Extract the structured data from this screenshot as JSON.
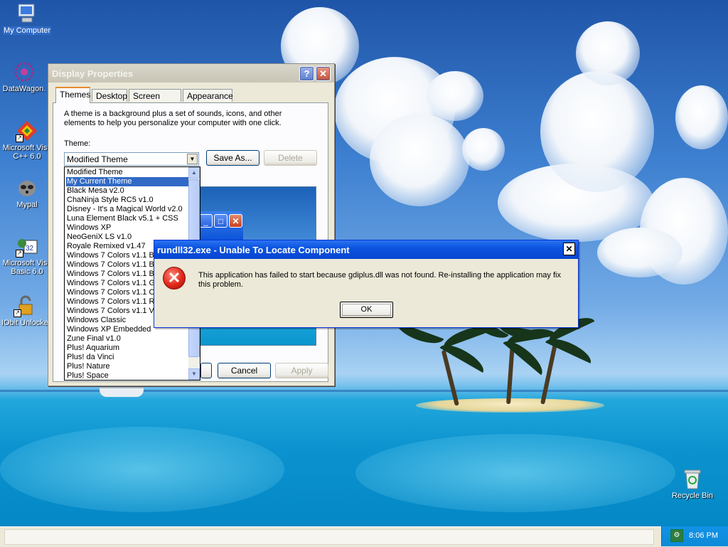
{
  "desktop": {
    "icons": [
      {
        "label": "My Computer"
      },
      {
        "label": "DataWagon."
      },
      {
        "label_line1": "Microsoft Visu",
        "label_line2": "C++ 6.0"
      },
      {
        "label": "Mypal"
      },
      {
        "label_line1": "Microsoft Visu",
        "label_line2": "Basic 6.0"
      },
      {
        "label": "IObit Unlocke"
      },
      {
        "label": "Recycle Bin"
      }
    ]
  },
  "display_properties": {
    "title": "Display Properties",
    "help_glyph": "?",
    "close_glyph": "✕",
    "tabs": [
      "Themes",
      "Desktop",
      "Screen Saver",
      "Appearance"
    ],
    "active_tab": "Themes",
    "description": "A theme is a background plus a set of sounds, icons, and other elements to help you personalize your computer with one click.",
    "theme_label": "Theme:",
    "theme_value": "Modified Theme",
    "save_as_label": "Save As...",
    "delete_label": "Delete",
    "cancel_label": "Cancel",
    "apply_label": "Apply",
    "theme_options": [
      "Modified Theme",
      "My Current Theme",
      "Black Mesa v2.0",
      "ChaNinja Style RC5 v1.0",
      "Disney - It's a Magical World v2.0",
      "Luna Element Black v5.1 + CSS",
      "Windows XP",
      "NeoGeniX LS v1.0",
      "Royale Remixed v1.47",
      "Windows 7 Colors v1.1 Bl",
      "Windows 7 Colors v1.1 Bl",
      "Windows 7 Colors v1.1 Br",
      "Windows 7 Colors v1.1 Gr",
      "Windows 7 Colors v1.1 Or",
      "Windows 7 Colors v1.1 Re",
      "Windows 7 Colors v1.1 Vi",
      "Windows Classic",
      "Windows XP Embedded",
      "Zune Final v1.0",
      "Plus! Aquarium",
      "Plus! da Vinci",
      "Plus! Nature",
      "Plus! Space"
    ],
    "selected_option_index": 1
  },
  "error_dialog": {
    "title": "rundll32.exe - Unable To Locate Component",
    "close_glyph": "✕",
    "message": "This application has failed to start because gdiplus.dll was not found. Re-installing the application may fix this problem.",
    "ok_label": "OK",
    "icon": "error-x-icon"
  },
  "taskbar": {
    "clock": "8:06 PM"
  },
  "colors": {
    "selection": "#316ac5",
    "error_title": "#0b54e0"
  }
}
